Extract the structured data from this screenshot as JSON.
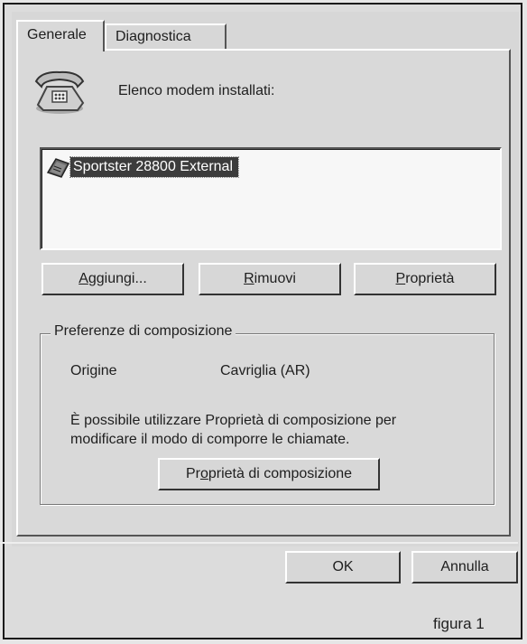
{
  "tabs": [
    {
      "label": "Generale",
      "active": true
    },
    {
      "label": "Diagnostica",
      "active": false
    }
  ],
  "modems": {
    "heading": "Elenco modem installati:",
    "items": [
      "Sportster 28800 External"
    ],
    "selected_index": 0
  },
  "modem_buttons": {
    "add": {
      "mnemonic": "A",
      "rest": "ggiungi..."
    },
    "remove": {
      "mnemonic": "R",
      "rest": "imuovi"
    },
    "properties": {
      "mnemonic": "P",
      "rest": "roprietà"
    }
  },
  "dialing_prefs": {
    "title": "Preferenze di composizione",
    "origin_label": "Origine",
    "origin_value": "Cavriglia (AR)",
    "description_line1": "È possibile utilizzare Proprietà di composizione per",
    "description_line2": "modificare il modo di comporre le chiamate.",
    "button": {
      "pre": "Pr",
      "mnemonic": "o",
      "rest": "prietà di composizione"
    }
  },
  "footer": {
    "ok": "OK",
    "cancel": "Annulla"
  },
  "caption": "figura 1",
  "icons": {
    "phone": "telephone-icon",
    "modem": "modem-icon"
  }
}
